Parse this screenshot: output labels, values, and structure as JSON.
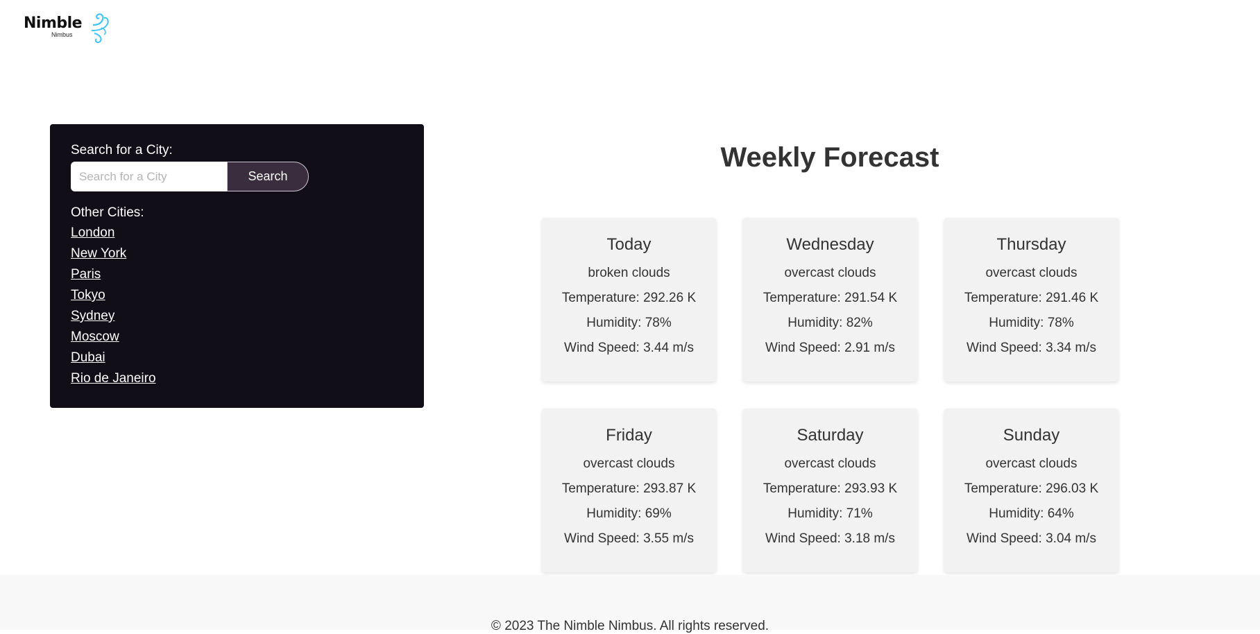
{
  "brand": {
    "name": "Nimble",
    "sub": "Nimbus",
    "icon": "wind-swirl-icon",
    "accent": "#3fc3f0"
  },
  "sidebar": {
    "search_label": "Search for a City:",
    "search_placeholder": "Search for a City",
    "search_value": "",
    "search_button": "Search",
    "other_label": "Other Cities:",
    "cities": [
      "London",
      "New York",
      "Paris",
      "Tokyo",
      "Sydney",
      "Moscow",
      "Dubai",
      "Rio de Janeiro"
    ],
    "background": "#120e18"
  },
  "forecast": {
    "title": "Weekly Forecast",
    "days": [
      {
        "day": "Today",
        "description": "broken clouds",
        "temperature": "Temperature: 292.26 K",
        "humidity": "Humidity: 78%",
        "wind": "Wind Speed: 3.44 m/s"
      },
      {
        "day": "Wednesday",
        "description": "overcast clouds",
        "temperature": "Temperature: 291.54 K",
        "humidity": "Humidity: 82%",
        "wind": "Wind Speed: 2.91 m/s"
      },
      {
        "day": "Thursday",
        "description": "overcast clouds",
        "temperature": "Temperature: 291.46 K",
        "humidity": "Humidity: 78%",
        "wind": "Wind Speed: 3.34 m/s"
      },
      {
        "day": "Friday",
        "description": "overcast clouds",
        "temperature": "Temperature: 293.87 K",
        "humidity": "Humidity: 69%",
        "wind": "Wind Speed: 3.55 m/s"
      },
      {
        "day": "Saturday",
        "description": "overcast clouds",
        "temperature": "Temperature: 293.93 K",
        "humidity": "Humidity: 71%",
        "wind": "Wind Speed: 3.18 m/s"
      },
      {
        "day": "Sunday",
        "description": "overcast clouds",
        "temperature": "Temperature: 296.03 K",
        "humidity": "Humidity: 64%",
        "wind": "Wind Speed: 3.04 m/s"
      }
    ]
  },
  "footer": {
    "text": "© 2023 The Nimble Nimbus. All rights reserved."
  }
}
